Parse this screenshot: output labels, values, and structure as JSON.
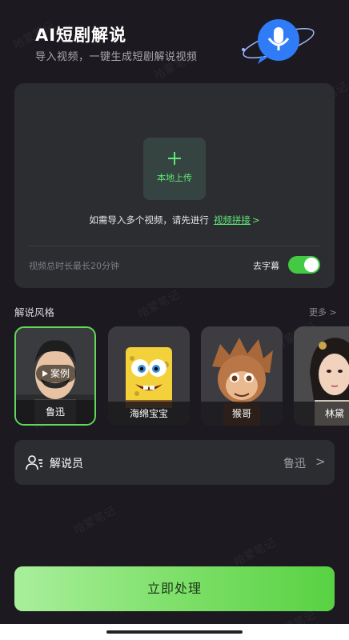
{
  "header": {
    "title": "AI短剧解说",
    "subtitle": "导入视频，一键生成短剧解说视频",
    "mascot_icon": "microphone-mascot-icon"
  },
  "upload": {
    "button_label": "本地上传",
    "hint_text": "如需导入多个视频，请先进行",
    "hint_link": "视频拼接",
    "hint_chevron": ">",
    "duration_note": "视频总时长最长20分钟",
    "subtitle_toggle_label": "去字幕",
    "subtitle_toggle_on": true
  },
  "styles": {
    "section_title": "解说风格",
    "more_label": "更多 >",
    "case_badge": "案例",
    "items": [
      {
        "name": "鲁迅",
        "selected": true
      },
      {
        "name": "海绵宝宝",
        "selected": false
      },
      {
        "name": "猴哥",
        "selected": false
      },
      {
        "name": "林黛",
        "selected": false
      }
    ]
  },
  "narrator": {
    "label": "解说员",
    "value": "鲁迅",
    "chevron": ">"
  },
  "action": {
    "process_label": "立即处理"
  },
  "watermark_text": "哈蒙笔记",
  "colors": {
    "accent": "#5fe877",
    "toggle_on": "#43c943",
    "background": "#1c1920",
    "card": "#2b2d31"
  }
}
